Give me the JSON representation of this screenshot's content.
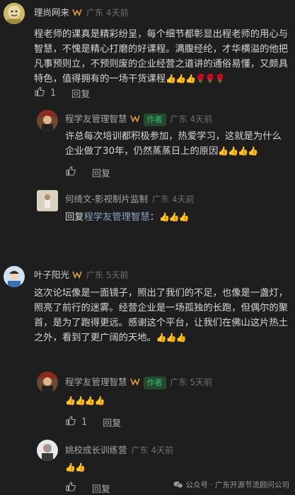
{
  "comments": [
    {
      "author": "理尚网来",
      "location": "广东",
      "time": "4天前",
      "text": "程老师的课真是精彩纷呈，每个细节都彰显出程老师的用心与智慧，不愧是精心打磨的好课程。满腹经纶，才华横溢的他把凡事预则立，不预则废的企业经营之道讲的通俗易懂，又颇具特色，值得拥有的一场干货课程",
      "emoji": "👍👍👍🌹🌹🌹",
      "likes": "1",
      "reply_label": "回复",
      "replies": [
        {
          "author": "程学友管理智慧",
          "author_tag": "作者",
          "location": "广东",
          "time": "4天前",
          "text": "许总每次培训都积极参加，热爱学习，这就是为什么企业做了30年，仍然蒸蒸日上的原因",
          "emoji": "👍👍👍👍",
          "reply_label": "回复"
        },
        {
          "author": "何绮文-影视制片监制",
          "location": "广东",
          "time": "4天前",
          "reply_prefix": "回复",
          "reply_to": "程学友管理智慧",
          "text": "：",
          "emoji": "👍👍👍"
        }
      ]
    },
    {
      "author": "叶子阳光",
      "location": "广东",
      "time": "5天前",
      "text": "这次论坛像是一面镜子，照出了我们的不足，也像是一盏灯，照亮了前行的迷雾。经营企业是一场孤独的长跑，但偶尔的聚首，是为了跑得更远。感谢这个平台，让我们在佛山这片热土之外，看到了更广阔的天地。",
      "emoji": "👍👍👍",
      "reply_label": "回复",
      "replies": [
        {
          "author": "程学友管理智慧",
          "author_tag": "作者",
          "location": "广东",
          "time": "5天前",
          "emoji": "👍👍👍👍",
          "likes": "1",
          "reply_label": "回复"
        },
        {
          "author": "姚校成长训练营",
          "location": "广东",
          "time": "4天前",
          "emoji": "👍👍",
          "reply_label": "回复"
        }
      ]
    }
  ],
  "watermark": {
    "prefix": "公众号 ·",
    "name": "广东开源节流顾问公司"
  },
  "colors": {
    "background": "#1e1e1e",
    "author_tag_bg": "#234a31",
    "author_tag_text": "#36c16b",
    "link": "#8aa0c0",
    "badge": "#e3a13c"
  }
}
